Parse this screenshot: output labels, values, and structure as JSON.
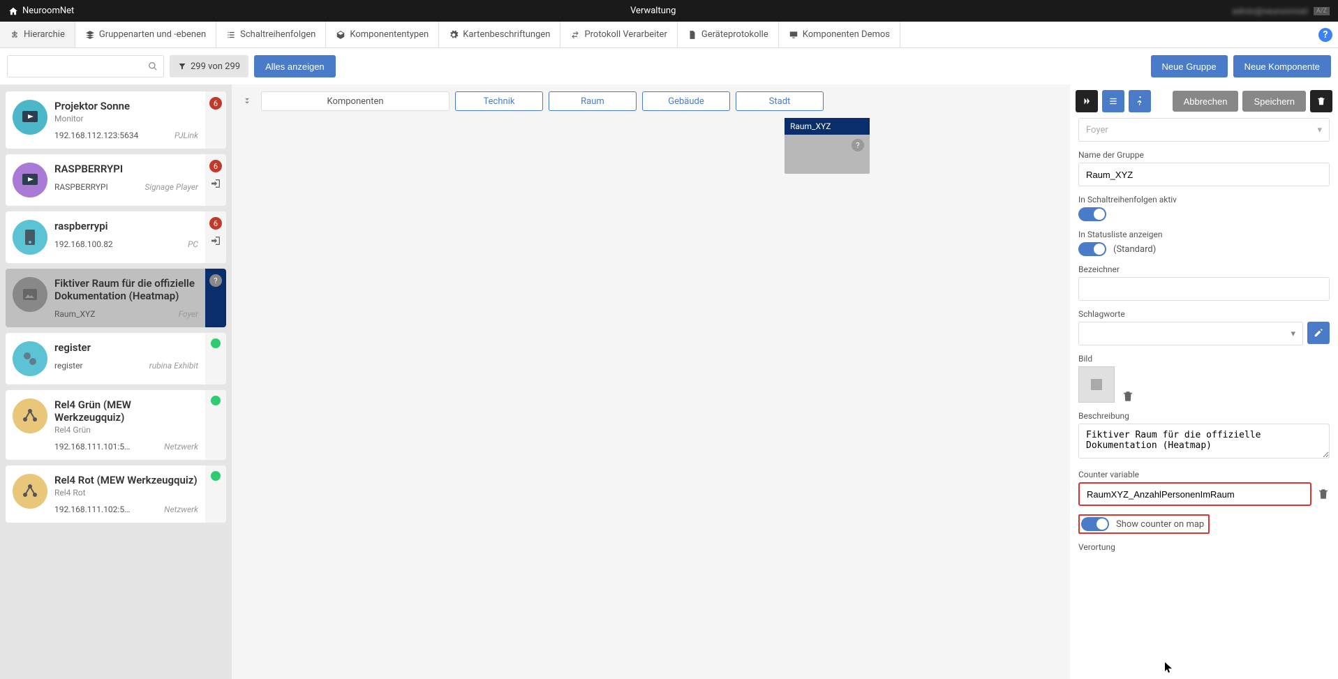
{
  "topbar": {
    "brand": "NeuroomNet",
    "title": "Verwaltung",
    "user": "admin"
  },
  "tabs": [
    {
      "label": "Hierarchie",
      "icon": "sitemap",
      "active": true
    },
    {
      "label": "Gruppenarten und -ebenen",
      "icon": "layers"
    },
    {
      "label": "Schaltreihenfolgen",
      "icon": "list"
    },
    {
      "label": "Komponententypen",
      "icon": "cube"
    },
    {
      "label": "Kartenbeschriftungen",
      "icon": "gear"
    },
    {
      "label": "Protokoll Verarbeiter",
      "icon": "swap"
    },
    {
      "label": "Geräteprotokolle",
      "icon": "doc"
    },
    {
      "label": "Komponenten Demos",
      "icon": "screen"
    }
  ],
  "toolbar": {
    "search_placeholder": "",
    "filter_label": "299 von 299",
    "show_all": "Alles anzeigen",
    "new_group": "Neue Gruppe",
    "new_component": "Neue Komponente"
  },
  "components": [
    {
      "title": "Projektor Sonne",
      "sub": "Monitor",
      "addr": "192.168.112.123:5634",
      "proto": "PJLink",
      "badge": "6",
      "badge_type": "red",
      "icon_bg": "#4bb7c9",
      "icon": "play-dark"
    },
    {
      "title": "RASPBERRYPI",
      "sub": "",
      "addr": "RASPBERRYPI",
      "proto": "Signage Player",
      "badge": "6",
      "badge_type": "red",
      "icon_bg": "#a97bd6",
      "icon": "play-dark",
      "login": true
    },
    {
      "title": "raspberrypi",
      "sub": "",
      "addr": "192.168.100.82",
      "proto": "PC",
      "badge": "6",
      "badge_type": "red",
      "icon_bg": "#5bc3d4",
      "icon": "server",
      "login": true
    },
    {
      "title": "Fiktiver Raum für die offizielle Dokumentation (Heatmap)",
      "sub": "",
      "addr": "Raum_XYZ",
      "proto": "Foyer",
      "badge": "?",
      "badge_type": "q",
      "icon_bg": "#888",
      "icon": "image",
      "selected": true
    },
    {
      "title": "register",
      "sub": "",
      "addr": "register",
      "proto": "rubina Exhibit",
      "badge": "",
      "badge_type": "green",
      "icon_bg": "#5bc3d4",
      "icon": "gears"
    },
    {
      "title": "Rel4 Grün (MEW Werkzeugquiz)",
      "sub": "Rel4 Grün",
      "addr": "192.168.111.101:5…",
      "proto": "Netzwerk",
      "badge": "",
      "badge_type": "green",
      "icon_bg": "#e8c77a",
      "icon": "nodes"
    },
    {
      "title": "Rel4 Rot (MEW Werkzeugquiz)",
      "sub": "Rel4 Rot",
      "addr": "192.168.111.102:5…",
      "proto": "Netzwerk",
      "badge": "",
      "badge_type": "green",
      "icon_bg": "#e8c77a",
      "icon": "nodes"
    }
  ],
  "canvas": {
    "columns_label": "Komponenten",
    "levels": [
      "Technik",
      "Raum",
      "Gebäude",
      "Stadt"
    ],
    "room_card": {
      "title": "Raum_XYZ"
    }
  },
  "panel": {
    "cancel": "Abbrechen",
    "save": "Speichern",
    "parent_value": "Foyer",
    "group_name_label": "Name der Gruppe",
    "group_name_value": "Raum_XYZ",
    "active_label": "In Schaltreihenfolgen aktiv",
    "statuslist_label": "In Statusliste anzeigen",
    "statuslist_hint": "(Standard)",
    "identifier_label": "Bezeichner",
    "identifier_value": "",
    "tags_label": "Schlagworte",
    "image_label": "Bild",
    "description_label": "Beschreibung",
    "description_value": "Fiktiver Raum für die offizielle Dokumentation (Heatmap)",
    "counter_label": "Counter variable",
    "counter_value": "RaumXYZ_AnzahlPersonenImRaum",
    "show_counter_label": "Show counter on map",
    "location_label": "Verortung"
  }
}
